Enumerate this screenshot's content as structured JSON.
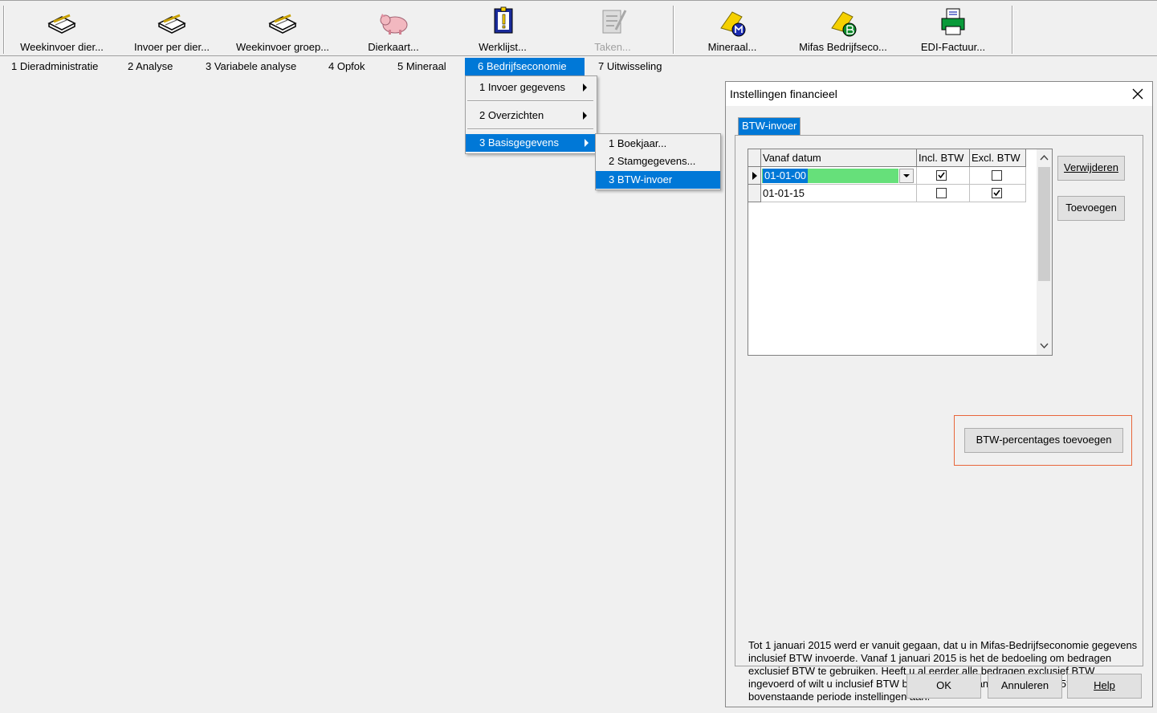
{
  "toolbar": {
    "buttons": [
      {
        "label": "Weekinvoer dier...",
        "icon": "notebook-pencil-icon"
      },
      {
        "label": "Invoer per dier...",
        "icon": "notebook-pencil-icon"
      },
      {
        "label": "Weekinvoer groep...",
        "icon": "notebook-pencil-icon"
      },
      {
        "label": "Dierkaart...",
        "icon": "pig-icon"
      },
      {
        "label": "Werklijst...",
        "icon": "clipboard-warning-icon"
      },
      {
        "label": "Taken...",
        "icon": "tasks-icon"
      },
      {
        "label": "Mineraal...",
        "icon": "mineral-m-icon"
      },
      {
        "label": "Mifas Bedrijfseco...",
        "icon": "mifas-b-icon"
      },
      {
        "label": "EDI-Factuur...",
        "icon": "printer-icon"
      }
    ]
  },
  "menubar": {
    "items": [
      {
        "label": "1  Dieradministratie"
      },
      {
        "label": "2  Analyse"
      },
      {
        "label": "3  Variabele analyse"
      },
      {
        "label": "4  Opfok"
      },
      {
        "label": "5  Mineraal"
      },
      {
        "label": "6  Bedrijfseconomie"
      },
      {
        "label": "7  Uitwisseling"
      }
    ]
  },
  "menu_bedrijfseconomie": {
    "items": [
      {
        "label": "1  Invoer gegevens"
      },
      {
        "label": "2  Overzichten"
      },
      {
        "label": "3  Basisgegevens"
      }
    ]
  },
  "menu_basisgegevens": {
    "items": [
      {
        "label": "1  Boekjaar..."
      },
      {
        "label": "2  Stamgegevens..."
      },
      {
        "label": "3  BTW-invoer"
      }
    ]
  },
  "dialog": {
    "title": "Instellingen financieel",
    "tab_label": "BTW-invoer",
    "grid": {
      "columns": [
        "Vanaf datum",
        "Incl. BTW",
        "Excl. BTW"
      ],
      "rows": [
        {
          "date": "01-01-00",
          "incl": true,
          "excl": false
        },
        {
          "date": "01-01-15",
          "incl": false,
          "excl": true
        }
      ]
    },
    "buttons": {
      "verwijderen": "Verwijderen",
      "toevoegen": "Toevoegen",
      "btw_percentages": "BTW-percentages toevoegen",
      "ok": "OK",
      "annuleren": "Annuleren",
      "help": "Help"
    },
    "note": "Tot 1 januari 2015 werd er vanuit gegaan, dat u in Mifas-Bedrijfseconomie gegevens inclusief BTW invoerde. Vanaf 1 januari 2015 is het de bedoeling om bedragen exclusief BTW te gebruiken. Heeft u al eerder alle bedragen exclusief BTW ingevoerd of wilt u inclusief BTW blijven boeken vanaf 1 januari 2015? Pas dan bovenstaande periode instellingen aan."
  },
  "colors": {
    "accent": "#0078d7",
    "highlight_border": "#e8663b",
    "selected_cell": "#66e07a"
  }
}
